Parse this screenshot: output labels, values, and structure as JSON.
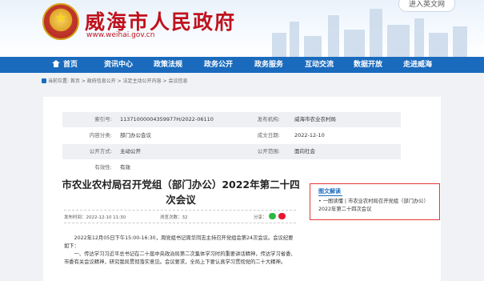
{
  "header": {
    "site_title": "威海市人民政府",
    "site_url": "www.weihai.gov.cn",
    "english_link": "进入英文网"
  },
  "nav": {
    "items": [
      "首页",
      "资讯中心",
      "政策法规",
      "政务公开",
      "政务服务",
      "互动交流",
      "数据开放",
      "走进威海"
    ]
  },
  "breadcrumb": "当前位置: 首页 > 政府信息公开 > 法定主动公开内容 > 会议信息",
  "meta": {
    "rows": [
      {
        "k1": "索引号:",
        "v1": "11371000004359977H/2022-06110",
        "k2": "发布机构:",
        "v2": "威海市农业农村局"
      },
      {
        "k1": "内容分类:",
        "v1": "部门办公会议",
        "k2": "成文日期:",
        "v2": "2022-12-10"
      },
      {
        "k1": "公开方式:",
        "v1": "主动公开",
        "k2": "公开范围:",
        "v2": "面向社会"
      },
      {
        "k1": "有效性:",
        "v1": "有效",
        "k2": "",
        "v2": ""
      }
    ]
  },
  "article": {
    "title": "市农业农村局召开党组（部门办公）2022年第二十四次会议",
    "date": "发布时间：2022-12-10 11:30",
    "views": "浏览次数：32",
    "share_label": "分享：",
    "paragraphs": [
      "2022年12月05日下午15:00-16:30，周党组书记周华同志主持召开党组会第24次会议。会议纪要如下：",
      "一、传达学习习近平总书记在二十届中央政治局第二次集体学习时的重要讲话精神，传达学习省委、市委有关会议精神，研究我局贯彻落实意见。会议要求，全局上下要认真学习贯彻党的二十大精神。"
    ]
  },
  "sidebar": {
    "heading": "图文解读",
    "link": "• 一图读懂 | 市农业农村局召开党组（部门办公）2022年第二十四次会议"
  }
}
